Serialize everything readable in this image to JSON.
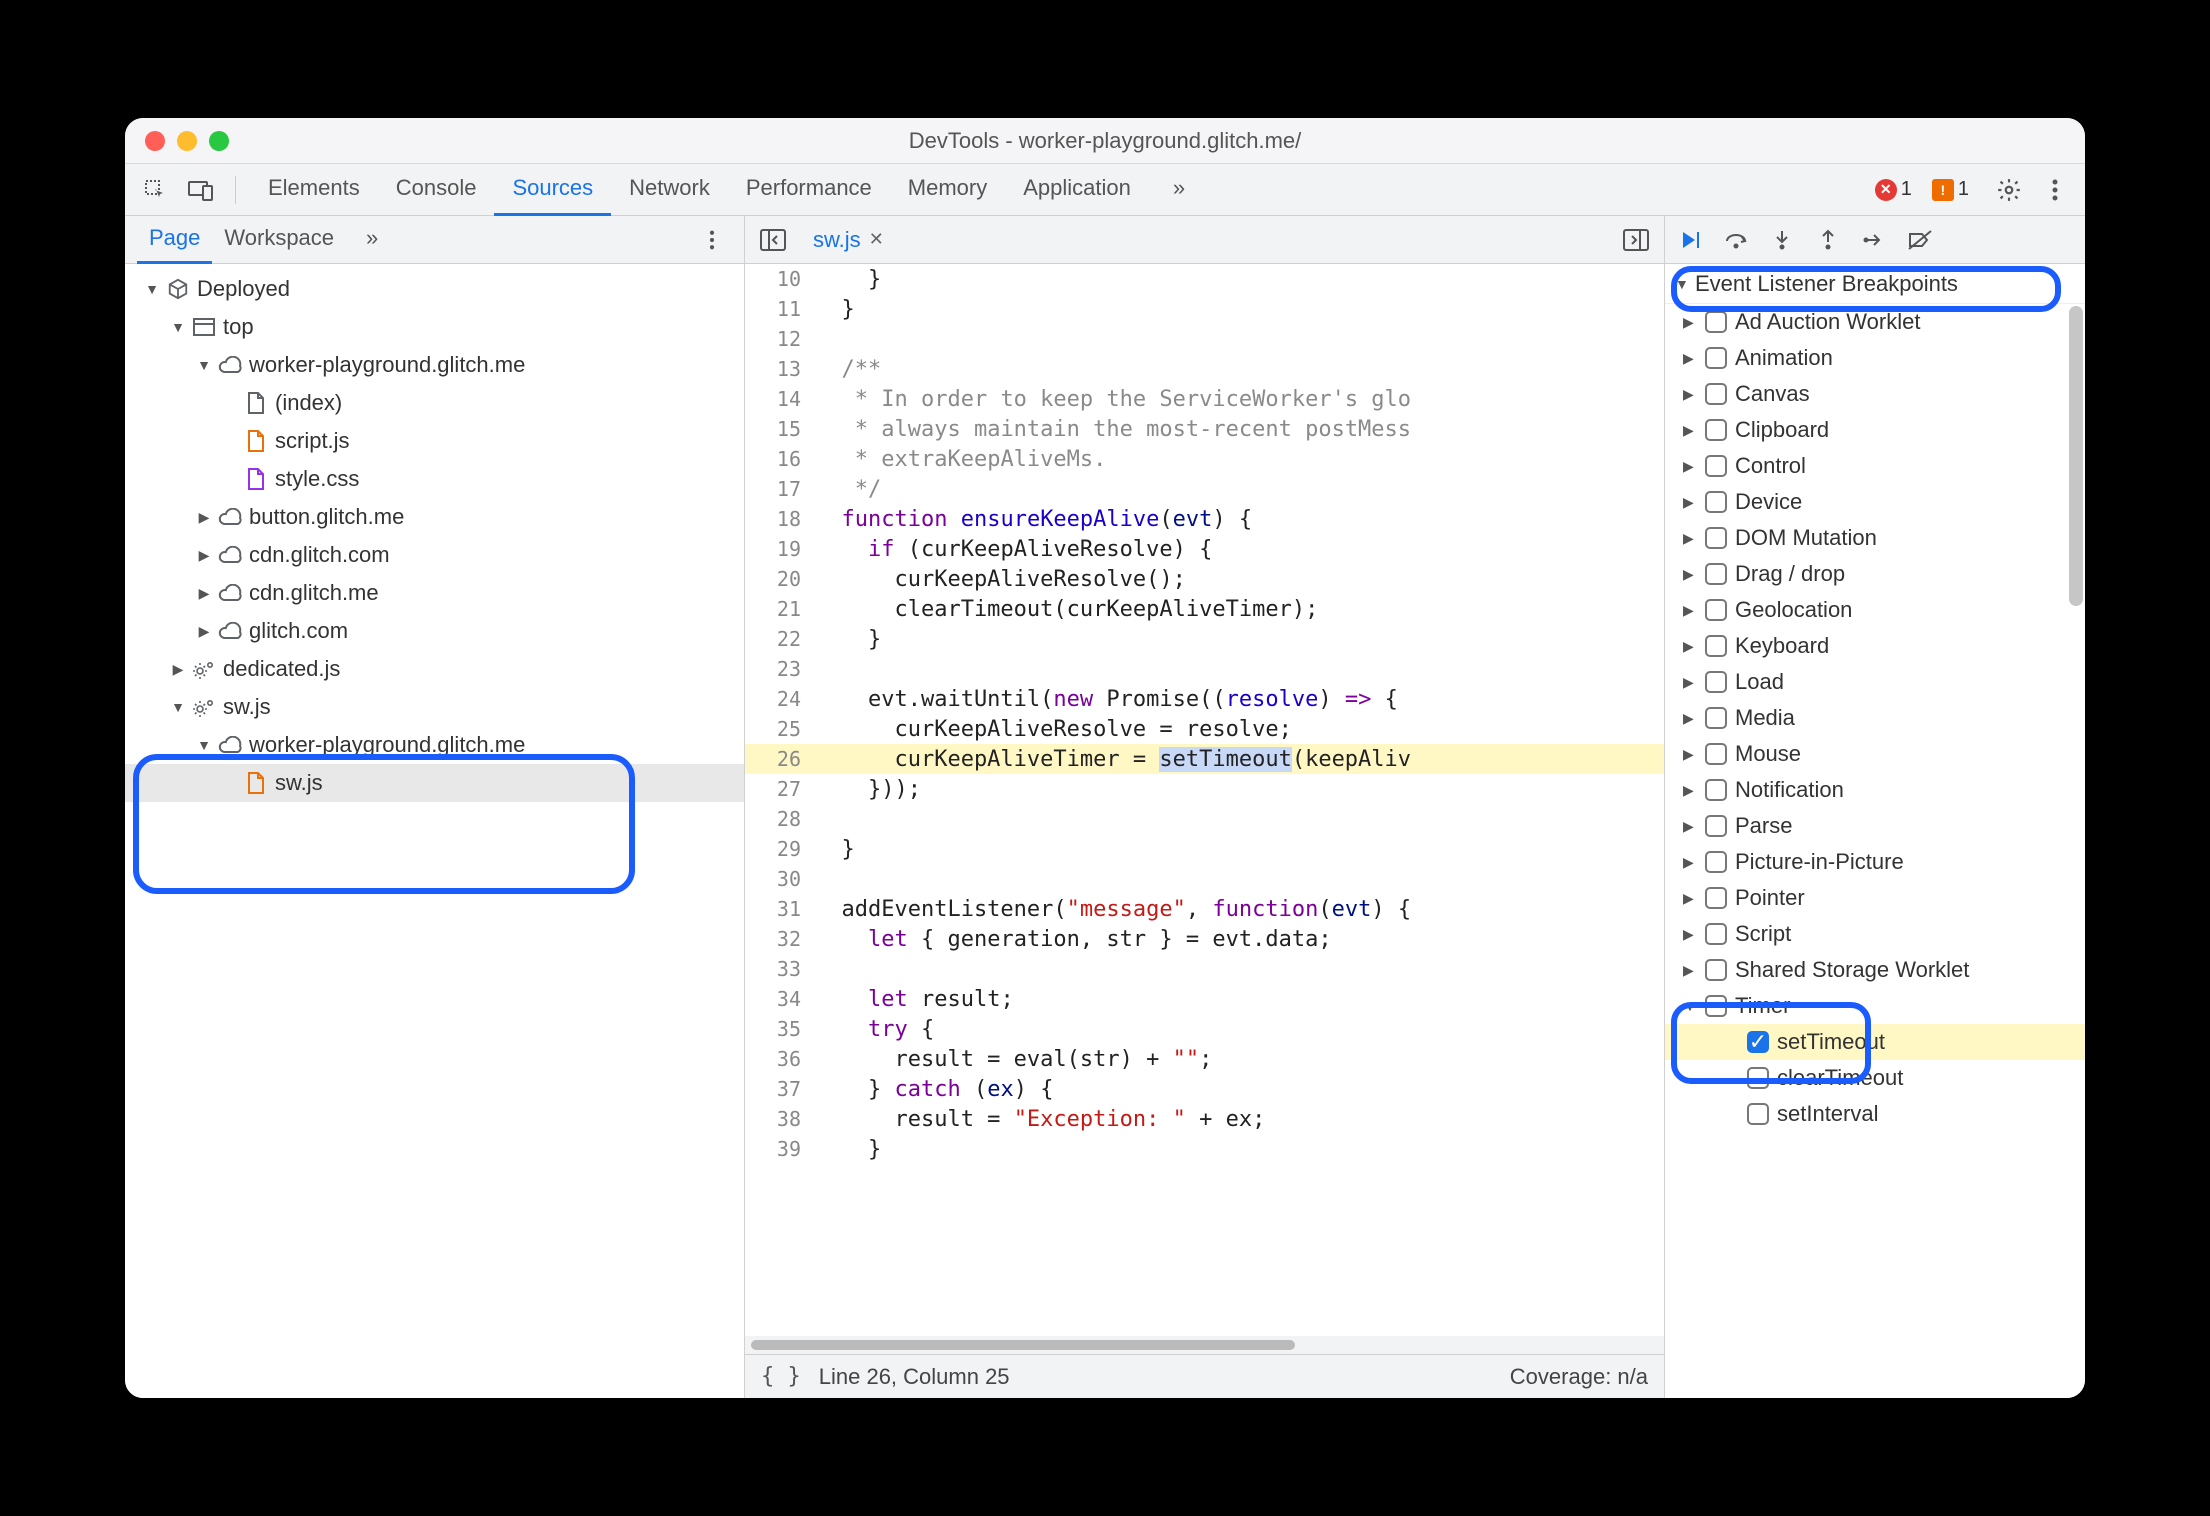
{
  "window": {
    "title": "DevTools - worker-playground.glitch.me/"
  },
  "mainTabs": {
    "items": [
      "Elements",
      "Console",
      "Sources",
      "Network",
      "Performance",
      "Memory",
      "Application"
    ],
    "activeIndex": 2,
    "overflow": "»"
  },
  "errors": {
    "count": "1"
  },
  "warnings": {
    "count": "1"
  },
  "leftTabs": {
    "items": [
      "Page",
      "Workspace"
    ],
    "activeIndex": 0,
    "overflow": "»"
  },
  "tree": [
    {
      "depth": 0,
      "disc": "▼",
      "icon": "cube",
      "label": "Deployed"
    },
    {
      "depth": 1,
      "disc": "▼",
      "icon": "frame",
      "label": "top"
    },
    {
      "depth": 2,
      "disc": "▼",
      "icon": "cloud",
      "label": "worker-playground.glitch.me"
    },
    {
      "depth": 3,
      "disc": "",
      "icon": "file",
      "label": "(index)"
    },
    {
      "depth": 3,
      "disc": "",
      "icon": "file-js",
      "label": "script.js"
    },
    {
      "depth": 3,
      "disc": "",
      "icon": "file-css",
      "label": "style.css"
    },
    {
      "depth": 2,
      "disc": "▶",
      "icon": "cloud",
      "label": "button.glitch.me"
    },
    {
      "depth": 2,
      "disc": "▶",
      "icon": "cloud",
      "label": "cdn.glitch.com"
    },
    {
      "depth": 2,
      "disc": "▶",
      "icon": "cloud",
      "label": "cdn.glitch.me"
    },
    {
      "depth": 2,
      "disc": "▶",
      "icon": "cloud",
      "label": "glitch.com"
    },
    {
      "depth": 1,
      "disc": "▶",
      "icon": "gears",
      "label": "dedicated.js"
    },
    {
      "depth": 1,
      "disc": "▼",
      "icon": "gears",
      "label": "sw.js"
    },
    {
      "depth": 2,
      "disc": "▼",
      "icon": "cloud",
      "label": "worker-playground.glitch.me"
    },
    {
      "depth": 3,
      "disc": "",
      "icon": "file-js",
      "label": "sw.js",
      "selected": true
    }
  ],
  "openFile": {
    "name": "sw.js"
  },
  "code": {
    "startLine": 10,
    "lines": [
      {
        "n": 10,
        "html": "    <span class='c-punc'>}</span>"
      },
      {
        "n": 11,
        "html": "  <span class='c-punc'>}</span>"
      },
      {
        "n": 12,
        "html": ""
      },
      {
        "n": 13,
        "html": "  <span class='c-comment'>/**</span>"
      },
      {
        "n": 14,
        "html": "  <span class='c-comment'> * In order to keep the ServiceWorker's glo</span>"
      },
      {
        "n": 15,
        "html": "  <span class='c-comment'> * always maintain the most-recent postMess</span>"
      },
      {
        "n": 16,
        "html": "  <span class='c-comment'> * extraKeepAliveMs.</span>"
      },
      {
        "n": 17,
        "html": "  <span class='c-comment'> */</span>"
      },
      {
        "n": 18,
        "html": "  <span class='c-purple'>function</span> <span class='c-blue'>ensureKeepAlive</span>(<span class='c-id'>evt</span>) {"
      },
      {
        "n": 19,
        "html": "    <span class='c-purple'>if</span> (curKeepAliveResolve) {"
      },
      {
        "n": 20,
        "html": "      curKeepAliveResolve();"
      },
      {
        "n": 21,
        "html": "      clearTimeout(curKeepAliveTimer);"
      },
      {
        "n": 22,
        "html": "    }"
      },
      {
        "n": 23,
        "html": ""
      },
      {
        "n": 24,
        "html": "    evt.waitUntil(<span class='c-purple'>new</span> Promise((<span class='c-blue'>resolve</span>) <span class='c-purple'>=&gt;</span> {"
      },
      {
        "n": 25,
        "html": "      curKeepAliveResolve = resolve;"
      },
      {
        "n": 26,
        "hl": true,
        "html": "      curKeepAliveTimer = <span class='tok-hl'>setTimeout</span>(keepAliv"
      },
      {
        "n": 27,
        "html": "    }));"
      },
      {
        "n": 28,
        "html": ""
      },
      {
        "n": 29,
        "html": "  }"
      },
      {
        "n": 30,
        "html": ""
      },
      {
        "n": 31,
        "html": "  addEventListener(<span class='c-str'>\"message\"</span>, <span class='c-purple'>function</span>(<span class='c-id'>evt</span>) {"
      },
      {
        "n": 32,
        "html": "    <span class='c-purple'>let</span> { generation, str } = evt.data;"
      },
      {
        "n": 33,
        "html": ""
      },
      {
        "n": 34,
        "html": "    <span class='c-purple'>let</span> result;"
      },
      {
        "n": 35,
        "html": "    <span class='c-purple'>try</span> {"
      },
      {
        "n": 36,
        "html": "      result = eval(str) + <span class='c-str'>\"\"</span>;"
      },
      {
        "n": 37,
        "html": "    } <span class='c-purple'>catch</span> (<span class='c-id'>ex</span>) {"
      },
      {
        "n": 38,
        "html": "      result = <span class='c-str'>\"Exception: \"</span> + ex;"
      },
      {
        "n": 39,
        "html": "    }"
      }
    ]
  },
  "status": {
    "cursor": "Line 26, Column 25",
    "coverage": "Coverage: n/a"
  },
  "bpSection": {
    "title": "Event Listener Breakpoints"
  },
  "bpCategories": [
    {
      "disc": "▶",
      "check": "empty",
      "label": "Ad Auction Worklet"
    },
    {
      "disc": "▶",
      "check": "empty",
      "label": "Animation"
    },
    {
      "disc": "▶",
      "check": "empty",
      "label": "Canvas"
    },
    {
      "disc": "▶",
      "check": "empty",
      "label": "Clipboard"
    },
    {
      "disc": "▶",
      "check": "empty",
      "label": "Control"
    },
    {
      "disc": "▶",
      "check": "empty",
      "label": "Device"
    },
    {
      "disc": "▶",
      "check": "empty",
      "label": "DOM Mutation"
    },
    {
      "disc": "▶",
      "check": "empty",
      "label": "Drag / drop"
    },
    {
      "disc": "▶",
      "check": "empty",
      "label": "Geolocation"
    },
    {
      "disc": "▶",
      "check": "empty",
      "label": "Keyboard"
    },
    {
      "disc": "▶",
      "check": "empty",
      "label": "Load"
    },
    {
      "disc": "▶",
      "check": "empty",
      "label": "Media"
    },
    {
      "disc": "▶",
      "check": "empty",
      "label": "Mouse"
    },
    {
      "disc": "▶",
      "check": "empty",
      "label": "Notification"
    },
    {
      "disc": "▶",
      "check": "empty",
      "label": "Parse"
    },
    {
      "disc": "▶",
      "check": "empty",
      "label": "Picture-in-Picture"
    },
    {
      "disc": "▶",
      "check": "empty",
      "label": "Pointer"
    },
    {
      "disc": "▶",
      "check": "empty",
      "label": "Script"
    },
    {
      "disc": "▶",
      "check": "empty",
      "label": "Shared Storage Worklet"
    },
    {
      "disc": "▼",
      "check": "mixed",
      "label": "Timer"
    },
    {
      "disc": "",
      "check": "checked",
      "label": "setTimeout",
      "indent": 1,
      "hl": true
    },
    {
      "disc": "",
      "check": "empty",
      "label": "clearTimeout",
      "indent": 1
    },
    {
      "disc": "",
      "check": "empty",
      "label": "setInterval",
      "indent": 1
    }
  ]
}
